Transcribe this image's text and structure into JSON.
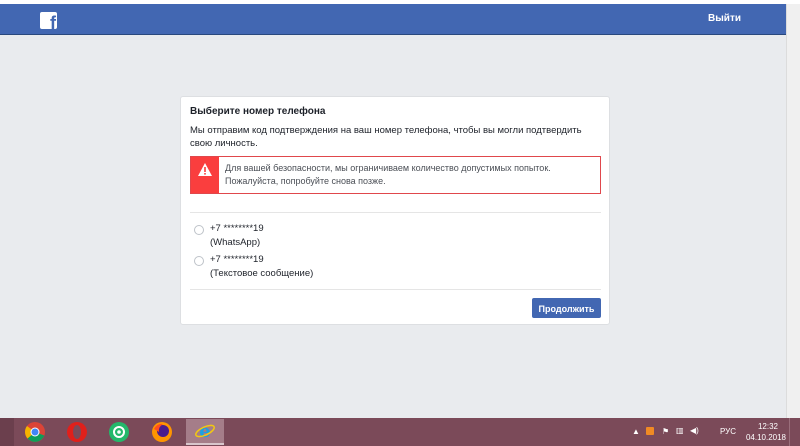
{
  "header": {
    "logo_letter": "f",
    "logout_label": "Выйти",
    "brand_color": "#4267b2"
  },
  "card": {
    "title": "Выберите номер телефона",
    "description": "Мы отправим код подтверждения на ваш номер телефона, чтобы вы могли подтвердить свою личность.",
    "alert": {
      "icon": "warning-icon",
      "text": "Для вашей безопасности, мы ограничиваем количество допустимых попыток. Пожалуйста, попробуйте снова позже.",
      "color": "#fa3e3e"
    },
    "options": [
      {
        "number": "+7 ********19",
        "method": "(WhatsApp)",
        "selected": false
      },
      {
        "number": "+7 ********19",
        "method": "(Текстовое сообщение)",
        "selected": false
      }
    ],
    "continue_label": "Продолжить"
  },
  "taskbar": {
    "apps": [
      "chrome-icon",
      "opera-icon",
      "icq-icon",
      "firefox-icon",
      "internet-explorer-icon"
    ],
    "active_app": "internet-explorer-icon",
    "tray": {
      "language": "РУС",
      "time": "12:32",
      "date": "04.10.2018"
    }
  }
}
